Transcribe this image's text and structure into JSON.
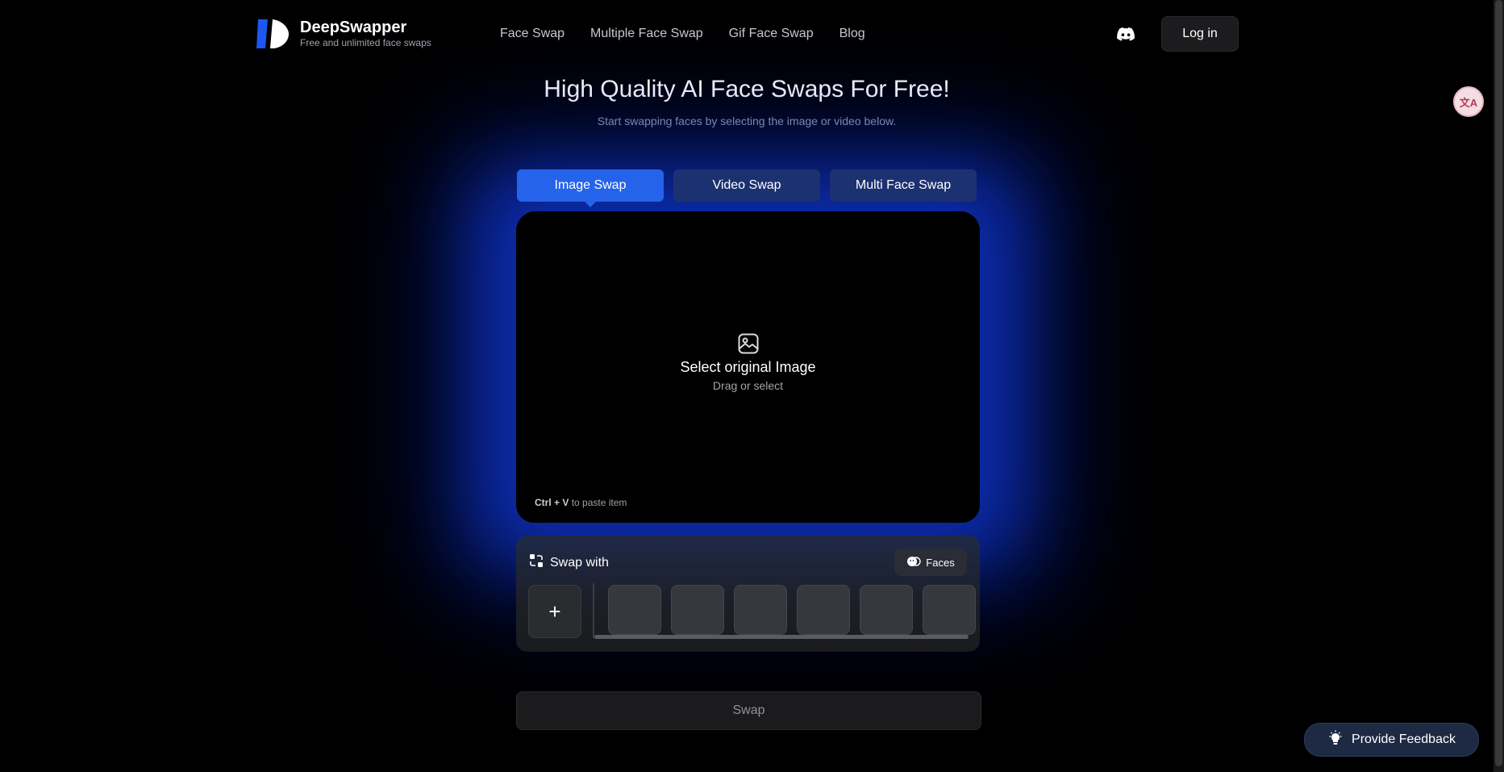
{
  "brand": {
    "name": "DeepSwapper",
    "tagline": "Free and unlimited face swaps",
    "accent": "#2563eb"
  },
  "nav": {
    "items": [
      "Face Swap",
      "Multiple Face Swap",
      "Gif Face Swap",
      "Blog"
    ]
  },
  "header": {
    "discord_icon": "discord-icon",
    "login_label": "Log in"
  },
  "translate_badge": "文A",
  "hero": {
    "title": "High Quality AI Face Swaps For Free!",
    "subtitle": "Start swapping faces by selecting the image or video below."
  },
  "tabs": [
    {
      "label": "Image Swap",
      "active": true
    },
    {
      "label": "Video Swap",
      "active": false
    },
    {
      "label": "Multi Face Swap",
      "active": false
    }
  ],
  "dropzone": {
    "icon": "image-icon",
    "title": "Select original Image",
    "subtitle": "Drag or select",
    "paste_shortcut": "Ctrl + V",
    "paste_text": "to paste item"
  },
  "swap_with": {
    "title": "Swap with",
    "faces_label": "Faces",
    "add_label": "+",
    "slot_count": 6
  },
  "swap_button": "Swap",
  "feedback": "Provide Feedback"
}
